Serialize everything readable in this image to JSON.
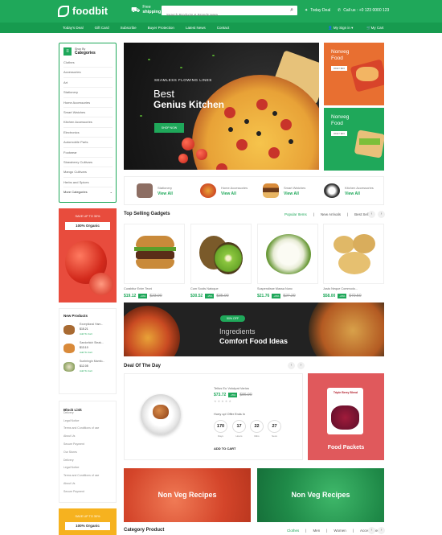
{
  "header": {
    "logo": "foodbit",
    "shipping_line1": "Free",
    "shipping_line2": "shipping",
    "search_placeholder": "Search Products & Brands Here...",
    "today_deal": "Today Deal",
    "call_us": "Call us : +0 123 0000 123"
  },
  "nav": {
    "items": [
      "Today's Deal",
      "Gift Card",
      "Subscribe",
      "Buyer Protection",
      "Latest News",
      "Contact"
    ],
    "sign_in": "My Sign in",
    "cart": "My Cart"
  },
  "sidebar": {
    "shop_by": "Shop By",
    "title": "Categories",
    "items": [
      "Clothes",
      "Accessories",
      "Art",
      "Stationery",
      "Home Accessories",
      "Smart Watches",
      "Kitchen Accessories",
      "Electronics",
      "Automobile Parts",
      "Footwear",
      "Strawberry Cultivars",
      "Mango Cultivars",
      "Herbs and Spices"
    ],
    "more": "More Categories"
  },
  "hero": {
    "subtitle": "SEAMLESS FLOWING LINES",
    "line1": "Best",
    "line2": "Genius Kitchen",
    "button": "SHOP NOW"
  },
  "side_banners": [
    {
      "title1": "Nonveg",
      "title2": "Food",
      "badge": "ONLY $23"
    },
    {
      "title1": "Nonveg",
      "title2": "Food",
      "badge": "ONLY $23"
    }
  ],
  "category_strip": [
    {
      "name": "Stationery",
      "link": "View All"
    },
    {
      "name": "Home Accessories",
      "link": "View All"
    },
    {
      "name": "Smart Watches",
      "link": "View All"
    },
    {
      "name": "Kitchen Accessories",
      "link": "View All"
    }
  ],
  "top_selling": {
    "title": "Top Selling Gadgets",
    "tabs": [
      "Popular Items",
      "New Arrivals",
      "Best Seller"
    ],
    "products": [
      {
        "name": "Curabitur Enim Tecni",
        "price": "$19.12",
        "discount": "-20%",
        "old": "$23.90"
      },
      {
        "name": "Cum Sociis Natoque",
        "price": "$30.52",
        "discount": "-15%",
        "old": "$35.90"
      },
      {
        "name": "Suspendisse Massa Nunc",
        "price": "$21.76",
        "discount": "-20%",
        "old": "$27.20"
      },
      {
        "name": "Justo Neque Commodo...",
        "price": "$58.00",
        "discount": "-20%",
        "old": "$72.50"
      }
    ]
  },
  "banner2": {
    "badge": "50% OFF",
    "line1": "Ingredients",
    "line2": "Comfort Food Ideas"
  },
  "deal": {
    "title": "Deal Of The Day",
    "product_name": "Tellus Eu Volutpat Varius",
    "price": "$73.72",
    "discount": "-15%",
    "old": "$86.90",
    "stars": "★★★★★",
    "hurry": "Hurry up! Offer Ends In",
    "countdown": [
      {
        "value": "170",
        "label": "Days"
      },
      {
        "value": "17",
        "label": "Hours"
      },
      {
        "value": "22",
        "label": "Mins"
      },
      {
        "value": "27",
        "label": "Secs"
      }
    ],
    "add_to_cart": "ADD TO CART"
  },
  "food_packets": {
    "title": "Food Packets",
    "bag_text": "Triple Berry Blend"
  },
  "nonveg_banners": [
    "Non Veg Recipes",
    "Non Veg Recipes"
  ],
  "category_product": {
    "title": "Category Product",
    "tabs": [
      "Clothes",
      "Men",
      "Women",
      "Accessories"
    ]
  },
  "promo1": {
    "save": "SAVE UP TO 30%",
    "ribbon": "100% Organic"
  },
  "promo2": {
    "save": "SAVE UP TO 30%",
    "ribbon": "100% Organic"
  },
  "new_products": {
    "title": "New Products",
    "items": [
      {
        "name": "Exceptional Ham...",
        "price": "$15.21",
        "action": "Add To Cart"
      },
      {
        "name": "Sandwhich Steak...",
        "price": "$13.10",
        "action": "Add To Cart"
      },
      {
        "name": "Sunbringin Mamfo...",
        "price": "$12.05",
        "action": "Add To Cart"
      }
    ]
  },
  "block_link": {
    "title": "Block Link",
    "items": [
      "Delivery",
      "Legal Notice",
      "Terms and Conditions of use",
      "About Us",
      "Secure Payment",
      "Our Stores",
      "Delivery",
      "Legal Notice",
      "Terms and Conditions of use",
      "About Us",
      "Secure Payment"
    ]
  },
  "colors": {
    "brand": "#1fa85a",
    "red": "#e0595c"
  }
}
